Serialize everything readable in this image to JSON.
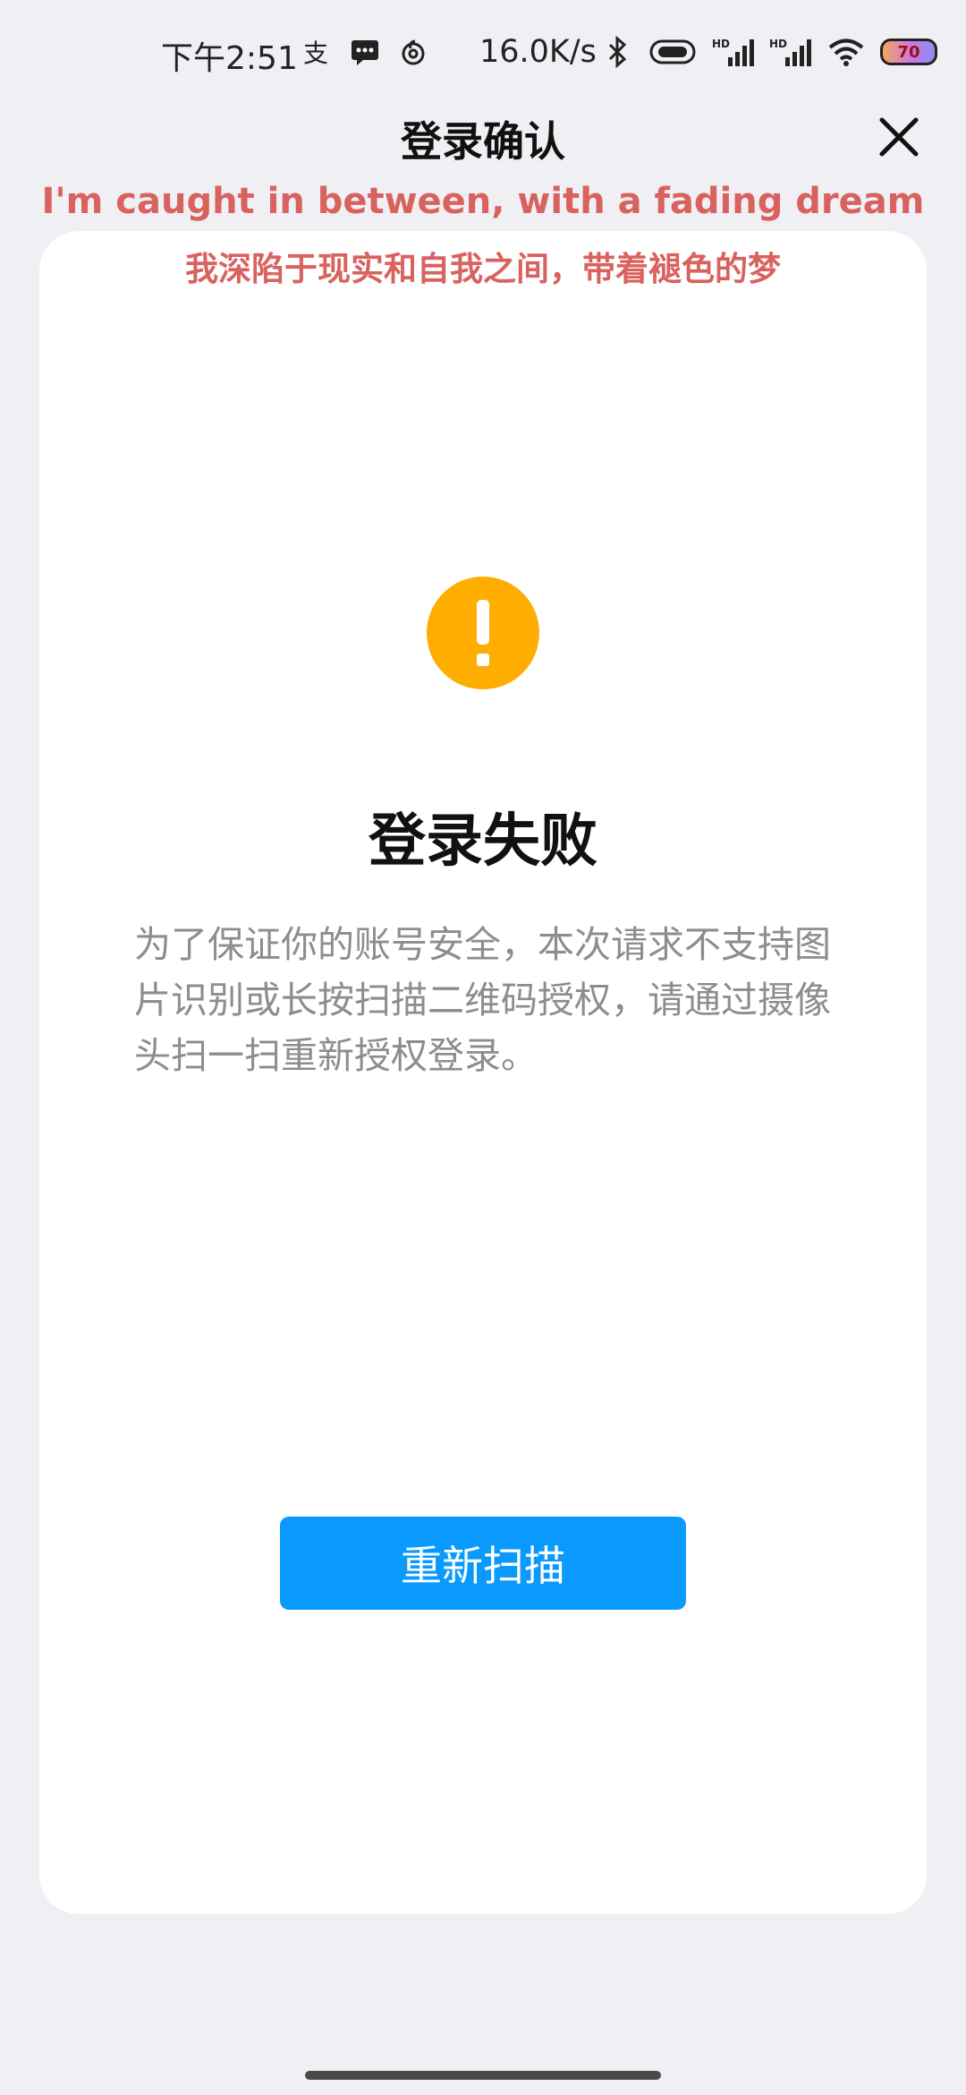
{
  "status_bar": {
    "time": "下午2:51",
    "net_speed": "16.0K/s",
    "battery_level": "70",
    "icons_left": [
      "alipay-icon",
      "message-icon",
      "netease-music-icon"
    ],
    "icons_right": [
      "bluetooth-icon",
      "vibrate-icon",
      "signal-hd-1-icon",
      "signal-hd-2-icon",
      "wifi-icon",
      "battery-icon"
    ]
  },
  "header": {
    "title": "登录确认",
    "close_icon": "close-icon"
  },
  "lyrics": {
    "english": "I'm caught in between, with a fading dream",
    "chinese": "我深陷于现实和自我之间，带着褪色的梦",
    "color": "#d9625f"
  },
  "card": {
    "status_icon": "warning-icon",
    "status_icon_color": "#ffad00",
    "title": "登录失败",
    "description": "为了保证你的账号安全，本次请求不支持图片识别或长按扫描二维码授权，请通过摄像头扫一扫重新授权登录。",
    "button_label": "重新扫描",
    "button_color": "#0a9afd"
  }
}
